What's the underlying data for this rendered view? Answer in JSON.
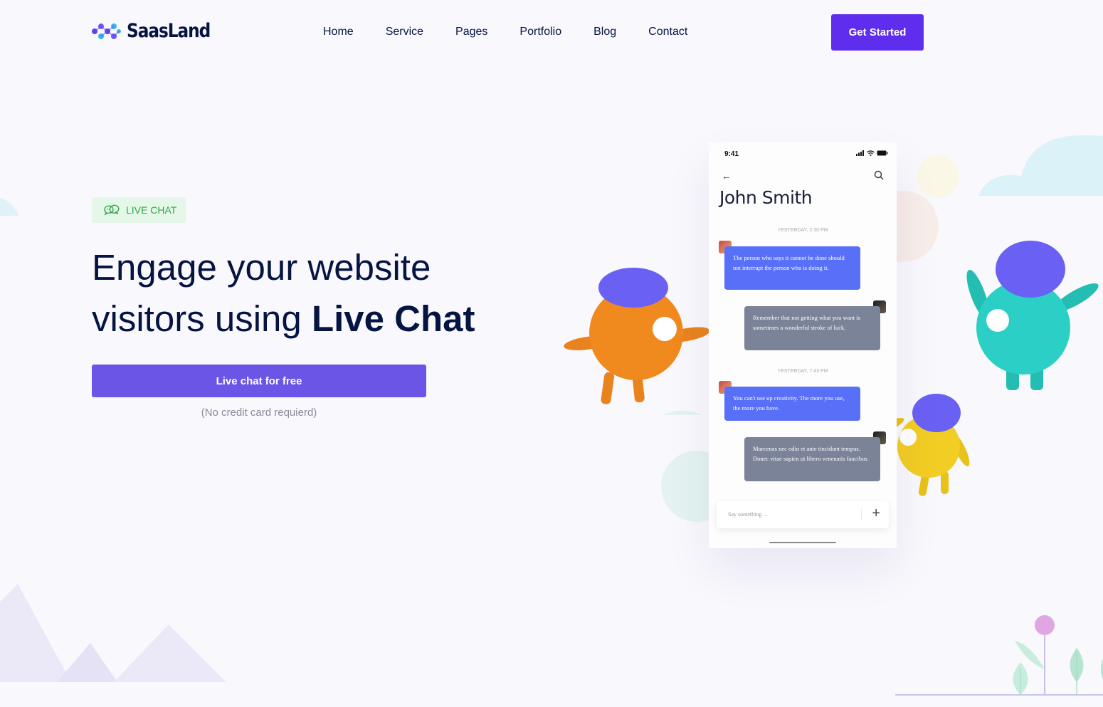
{
  "brand": {
    "name": "SaasLand"
  },
  "nav": {
    "items": [
      "Home",
      "Service",
      "Pages",
      "Portfolio",
      "Blog",
      "Contact"
    ]
  },
  "header": {
    "cta_label": "Get Started"
  },
  "hero": {
    "tag": "LIVE CHAT",
    "headline_line1": "Engage your website",
    "headline_line2_plain": "visitors using ",
    "headline_line2_bold": "Live Chat",
    "button_label": "Live chat for free",
    "note": "(No credit card requierd)"
  },
  "phone": {
    "time": "9:41",
    "contact_name": "John Smith",
    "messages": [
      {
        "day": "YESTERDAY, 2:30 PM"
      },
      {
        "direction": "in",
        "text": "The person who says it cannot be done should not interrupt the person who is doing it."
      },
      {
        "direction": "out",
        "text": "Remember that not getting what you want is sometimes a wonderful stroke of luck."
      },
      {
        "day": "YESTERDAY, 7:43 PM"
      },
      {
        "direction": "in",
        "text": "You can't use up creativity. The more you use, the more you have."
      },
      {
        "direction": "out",
        "text": "Maecenas nec odio et ante tincidunt tempus. Donec vitae sapien ut libero venenatis faucibus."
      }
    ],
    "compose_placeholder": "Say something ..."
  },
  "colors": {
    "primary": "#5f2ded",
    "button": "#6b55e6",
    "tag_green": "#2ca845",
    "text_dark": "#051441",
    "bubble_in": "#5870f7",
    "bubble_out": "#7b8398"
  },
  "icons": [
    "logo-icon",
    "chat-bubbles-icon",
    "back-arrow-icon",
    "search-icon",
    "signal-icon",
    "wifi-icon",
    "battery-icon",
    "plus-icon"
  ]
}
